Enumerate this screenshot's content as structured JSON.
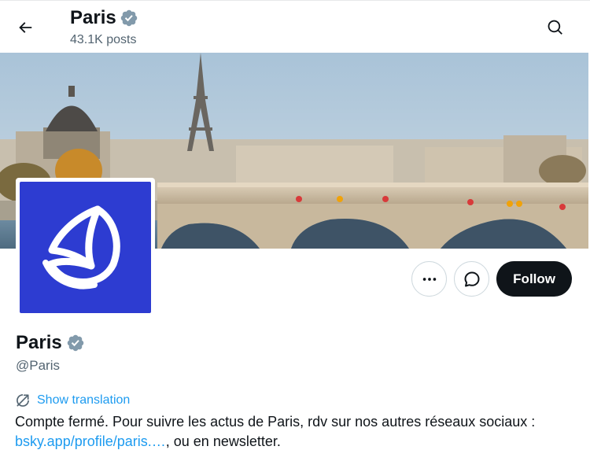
{
  "colors": {
    "accent": "#1d9bf0",
    "verified": "#829aab",
    "follow_bg": "#0f1419",
    "avatar_bg": "#2d3cd1",
    "secondary_text": "#536471"
  },
  "header": {
    "back_icon": "arrow-left-icon",
    "title": "Paris",
    "verified_icon": "verified-badge-icon",
    "post_count": "43.1K posts",
    "search_icon": "search-icon"
  },
  "banner": {
    "description_icon": "banner-image"
  },
  "profile": {
    "avatar_icon": "paris-logo-icon",
    "display_name": "Paris",
    "handle": "@Paris"
  },
  "actions": {
    "more_icon": "more-dots-icon",
    "message_icon": "message-bubble-icon",
    "follow_label": "Follow"
  },
  "translation": {
    "icon": "translate-icon",
    "label": "Show translation"
  },
  "bio": {
    "text_before": "Compte fermé. Pour suivre les actus de Paris, rdv sur nos autres réseaux sociaux : ",
    "link_text": "bsky.app/profile/paris.…",
    "text_after": ", ou en newsletter."
  }
}
